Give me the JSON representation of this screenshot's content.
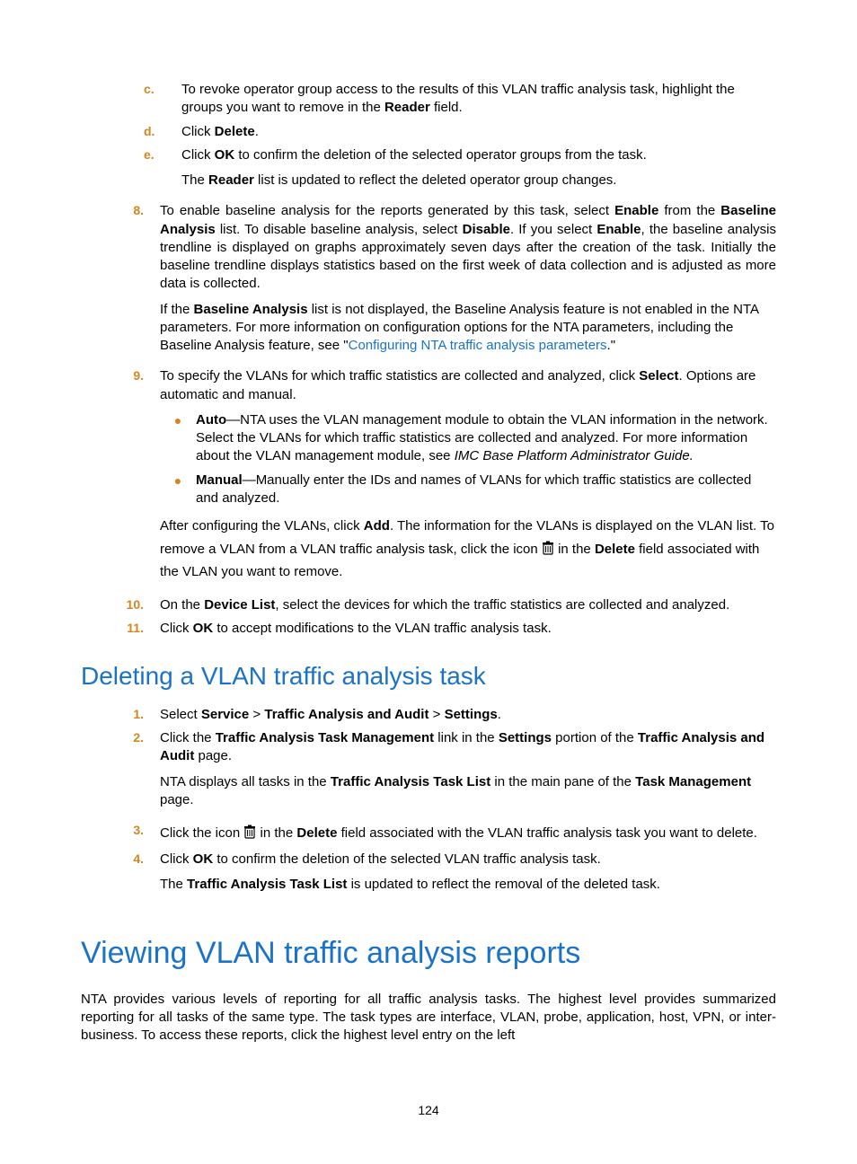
{
  "steps": {
    "c": {
      "text_pre": "To revoke operator group access to the results of this VLAN traffic analysis task, highlight the groups you want to remove in the ",
      "bold": "Reader",
      "text_post": " field."
    },
    "d": {
      "pre": "Click ",
      "b": "Delete",
      "post": "."
    },
    "e": {
      "pre": "Click ",
      "b": "OK",
      "post": " to confirm the deletion of the selected operator groups from the task.",
      "follow_pre": "The ",
      "follow_b": "Reader",
      "follow_post": " list is updated to reflect the deleted operator group changes."
    },
    "s8": {
      "seg1": "To enable baseline analysis for the reports generated by this task, select ",
      "b1": "Enable",
      "seg2": " from the ",
      "b2": "Baseline Analysis",
      "seg3": " list. To disable baseline analysis, select ",
      "b3": "Disable",
      "seg4": ". If you select ",
      "b4": "Enable",
      "seg5": ", the baseline analysis trendline is displayed on graphs approximately seven days after the creation of the task. Initially the baseline trendline displays statistics based on the first week of data collection and is adjusted as more data is collected.",
      "p2_seg1": "If the ",
      "p2_b1": "Baseline Analysis",
      "p2_seg2": " list is not displayed, the Baseline Analysis feature is not enabled in the NTA parameters. For more information on configuration options for the NTA parameters, including the Baseline Analysis feature, see \"",
      "p2_link": "Configuring NTA traffic analysis parameters",
      "p2_seg3": ".\""
    },
    "s9": {
      "seg1": "To specify the VLANs for which traffic statistics are collected and analyzed, click ",
      "b1": "Select",
      "seg2": ". Options are automatic and manual.",
      "auto_b": "Auto",
      "auto_seg": "—NTA uses the VLAN management module to obtain the VLAN information in the network. Select the VLANs for which traffic statistics are collected and analyzed. For more information about the VLAN management module, see ",
      "auto_ital": "IMC Base Platform Administrator Guide.",
      "man_b": "Manual",
      "man_seg": "—Manually enter the IDs and names of VLANs for which traffic statistics are collected and analyzed.",
      "after1": "After configuring the VLANs, click ",
      "after1_b": "Add",
      "after1_post": ". The information for the VLANs is displayed on the VLAN list. To remove a VLAN from a VLAN traffic analysis task, click the icon ",
      "after1_mid": " in the ",
      "after1_b2": "Delete",
      "after1_end": " field associated with the VLAN you want to remove."
    },
    "s10": {
      "pre": "On the ",
      "b": "Device List",
      "post": ", select the devices for which the traffic statistics are collected and analyzed."
    },
    "s11": {
      "pre": "Click ",
      "b": "OK",
      "post": " to accept modifications to the VLAN traffic analysis task."
    }
  },
  "deleting_heading": "Deleting a VLAN traffic analysis task",
  "del": {
    "s1": {
      "pre": "Select ",
      "b1": "Service",
      "gt1": " > ",
      "b2": "Traffic Analysis and Audit",
      "gt2": " > ",
      "b3": "Settings",
      "post": "."
    },
    "s2": {
      "pre": "Click the ",
      "b1": "Traffic Analysis Task Management",
      "mid1": " link in the ",
      "b2": "Settings",
      "mid2": " portion of the ",
      "b3": "Traffic Analysis and Audit",
      "post": " page.",
      "p2_pre": "NTA displays all tasks in the ",
      "p2_b1": "Traffic Analysis Task List",
      "p2_mid": " in the main pane of the ",
      "p2_b2": "Task Management",
      "p2_post": " page."
    },
    "s3": {
      "pre": "Click the icon ",
      "mid": " in the ",
      "b": "Delete",
      "post": " field associated with the VLAN traffic analysis task you want to delete."
    },
    "s4": {
      "pre": "Click ",
      "b": "OK",
      "post": " to confirm the deletion of the selected VLAN traffic analysis task.",
      "p2_pre": "The ",
      "p2_b": "Traffic Analysis Task List",
      "p2_post": " is updated to reflect the removal of the deleted task."
    }
  },
  "viewing_heading": "Viewing VLAN traffic analysis reports",
  "viewing_intro": "NTA provides various levels of reporting for all traffic analysis tasks. The highest level provides summarized reporting for all tasks of the same type. The task types are interface, VLAN, probe, application, host, VPN, or inter-business. To access these reports, click the highest level entry on the left",
  "labels": {
    "c": "c.",
    "d": "d.",
    "e": "e.",
    "n8": "8.",
    "n9": "9.",
    "n10": "10.",
    "n11": "11.",
    "n1": "1.",
    "n2": "2.",
    "n3": "3.",
    "n4": "4."
  },
  "page_number": "124"
}
